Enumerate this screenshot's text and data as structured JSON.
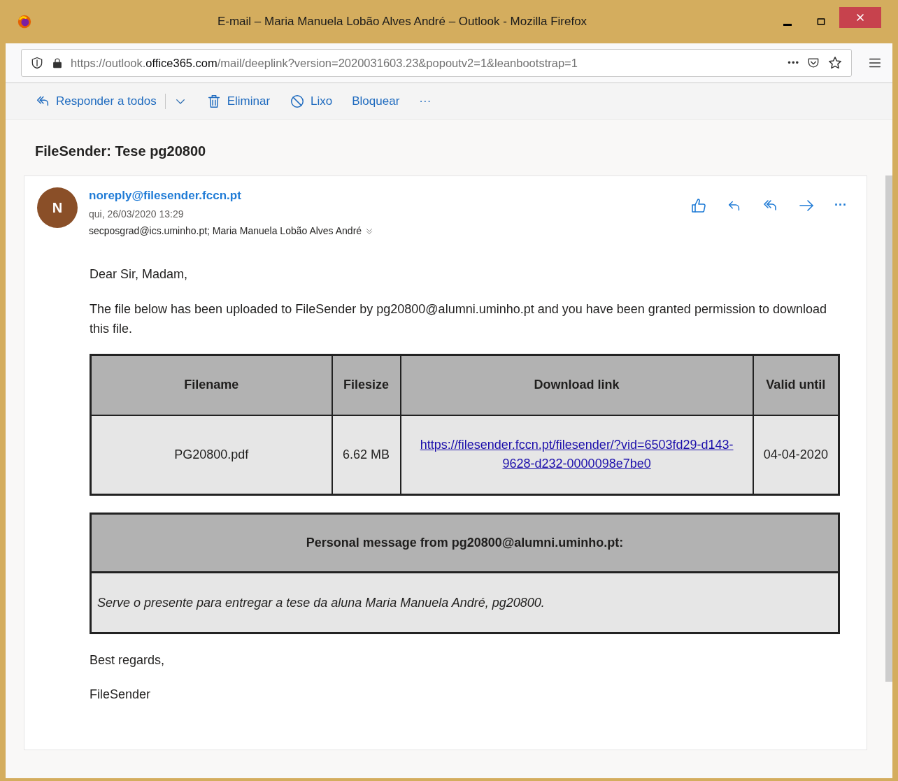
{
  "window": {
    "title": "E-mail – Maria Manuela Lobão Alves André – Outlook - Mozilla Firefox"
  },
  "address_bar": {
    "url_prefix": "https://outlook.",
    "url_domain": "office365.com",
    "url_suffix": "/mail/deeplink?version=2020031603.23&popoutv2=1&leanbootstrap=1",
    "more": "•••"
  },
  "toolbar": [
    {
      "kind": "reply-all",
      "label": "Responder a todos"
    },
    {
      "kind": "dropdown"
    },
    {
      "kind": "delete",
      "label": "Eliminar"
    },
    {
      "kind": "junk",
      "label": "Lixo"
    },
    {
      "kind": "plain",
      "label": "Bloquear"
    },
    {
      "kind": "more",
      "label": "···"
    }
  ],
  "subject": "FileSender: Tese pg20800",
  "message": {
    "avatar": "N",
    "sender": "noreply@filesender.fccn.pt",
    "date": "qui, 26/03/2020 13:29",
    "recipients": "secposgrad@ics.uminho.pt; Maria Manuela Lobão Alves André",
    "more": "···",
    "greeting": "Dear Sir, Madam,",
    "intro": "The file below has been uploaded to FileSender by pg20800@alumni.uminho.pt and you have been granted permission to download this file.",
    "table": {
      "columns": [
        "Filename",
        "Filesize",
        "Download link",
        "Valid until"
      ],
      "rows": [
        [
          "PG20800.pdf",
          "6.62 MB",
          "https://filesender.fccn.pt/filesender/?vid=6503fd29-d143-9628-d232-0000098e7be0",
          "04-04-2020"
        ]
      ]
    },
    "personal_message": {
      "heading": "Personal message from pg20800@alumni.uminho.pt:",
      "text": "Serve o presente para entregar a tese da aluna Maria Manuela André, pg20800."
    },
    "closing": "Best regards,",
    "signature": "FileSender"
  }
}
